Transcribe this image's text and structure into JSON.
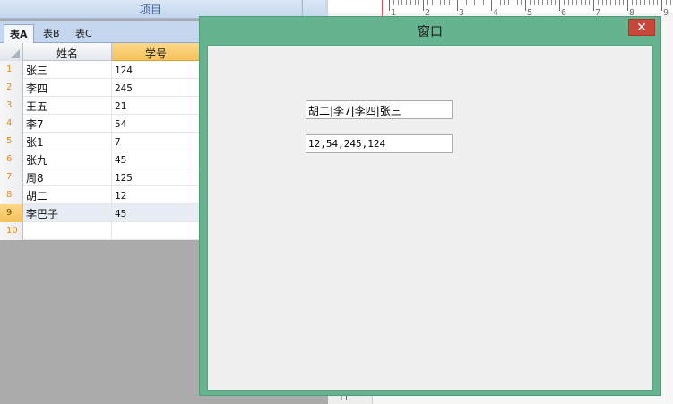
{
  "header": {
    "project_label": "项目"
  },
  "ruler": {
    "labels": [
      "1",
      "2",
      "3",
      "4",
      "5",
      "6",
      "7",
      "8",
      "9"
    ],
    "side_label": "11"
  },
  "tabs": [
    {
      "label": "表A",
      "active": true
    },
    {
      "label": "表B",
      "active": false
    },
    {
      "label": "表C",
      "active": false
    }
  ],
  "grid": {
    "columns": [
      "姓名",
      "学号"
    ],
    "rows": [
      {
        "num": "1",
        "name": "张三",
        "id": "124"
      },
      {
        "num": "2",
        "name": "李四",
        "id": "245"
      },
      {
        "num": "3",
        "name": "王五",
        "id": "21"
      },
      {
        "num": "4",
        "name": "李7",
        "id": "54"
      },
      {
        "num": "5",
        "name": "张1",
        "id": "7"
      },
      {
        "num": "6",
        "name": "张九",
        "id": "45"
      },
      {
        "num": "7",
        "name": "周8",
        "id": "125"
      },
      {
        "num": "8",
        "name": "胡二",
        "id": "12"
      },
      {
        "num": "9",
        "name": "李巴子",
        "id": "45"
      },
      {
        "num": "10",
        "name": "",
        "id": ""
      }
    ],
    "selected_row": "9",
    "selected_column": "学号"
  },
  "window": {
    "title": "窗口",
    "close_icon": "close-icon",
    "textbox1": {
      "value": "胡二|李7|李四|张三"
    },
    "textbox2": {
      "value": "12,54,245,124"
    }
  },
  "colors": {
    "window_frame": "#66b48f",
    "close_button": "#c9463b",
    "selection": "#f6c25a"
  }
}
